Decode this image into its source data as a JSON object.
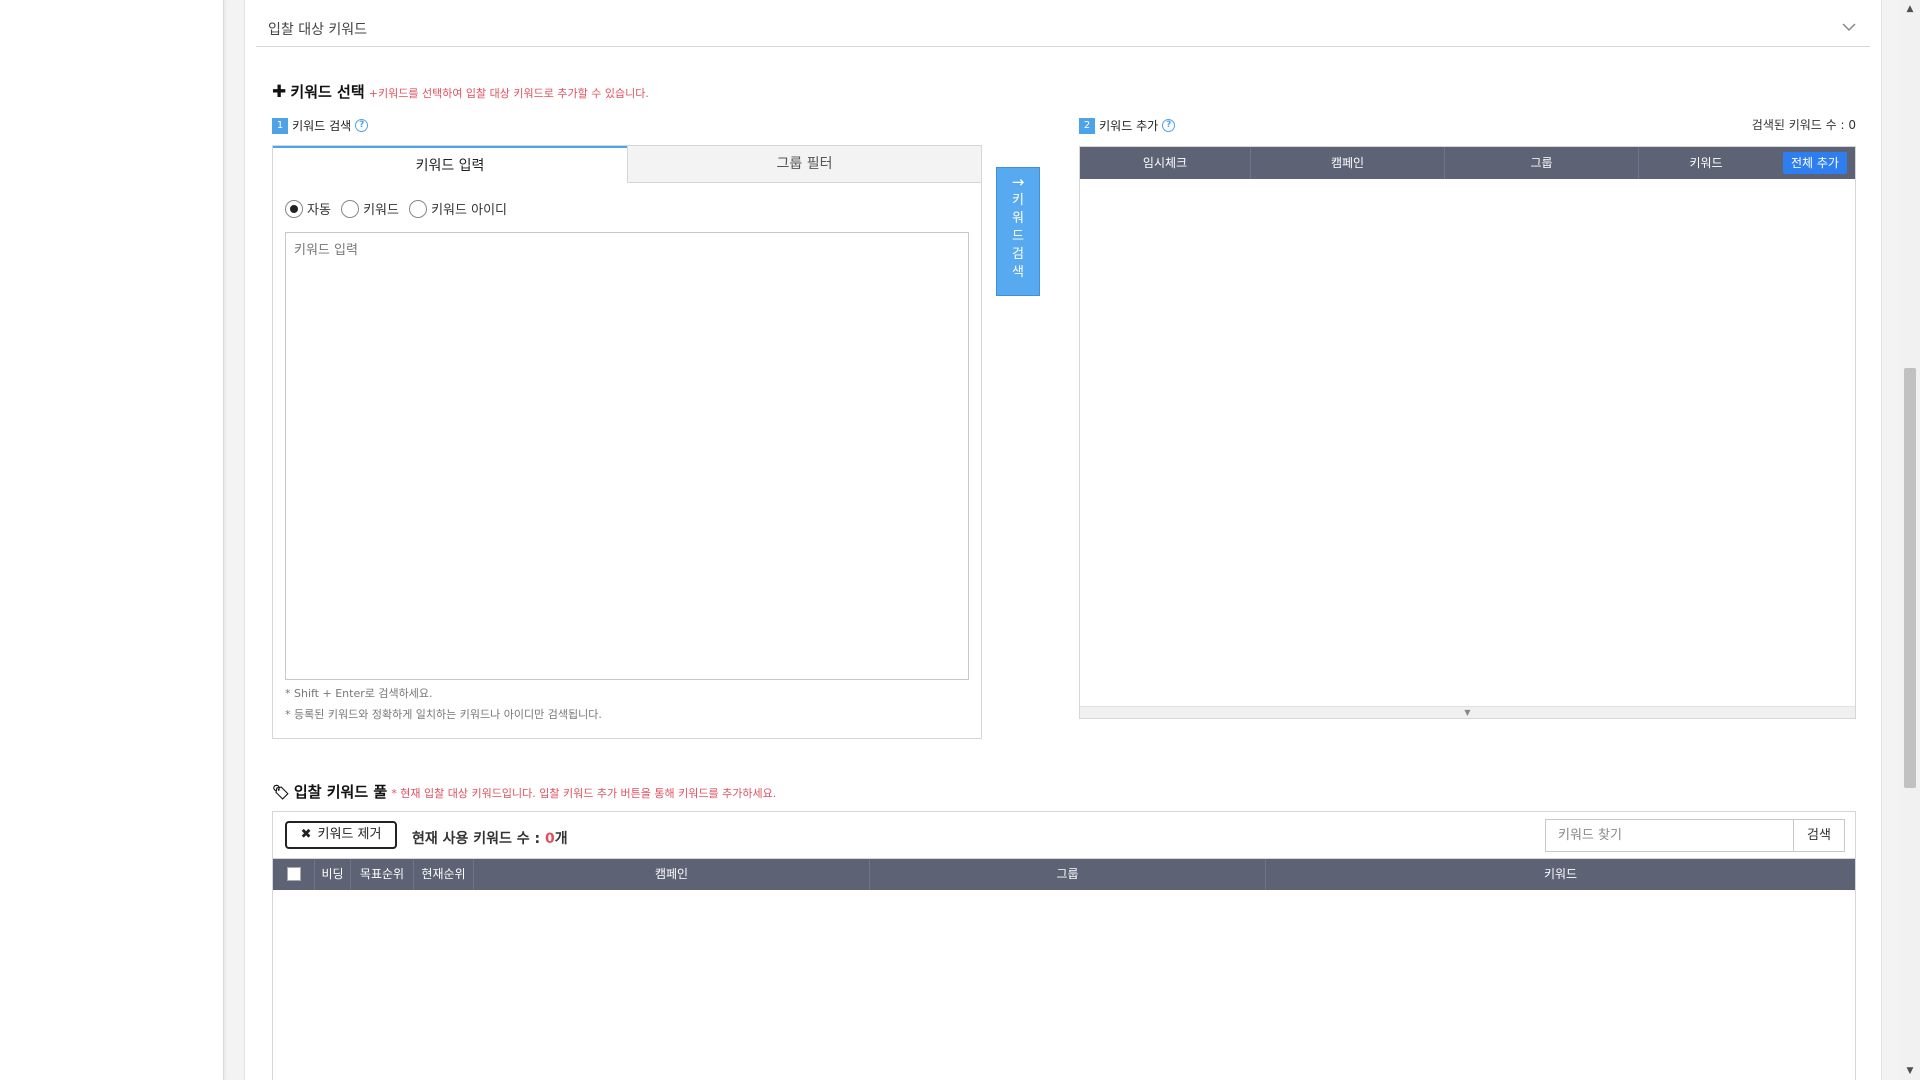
{
  "section": {
    "title": "입찰 대상 키워드"
  },
  "keyword_select": {
    "title": "키워드 선택",
    "description": "+키워드를 선택하여 입찰 대상 키워드로 추가할 수 있습니다.",
    "search": {
      "step": "1",
      "label": "키워드 검색",
      "tabs": [
        "키워드 입력",
        "그룹 필터"
      ],
      "radios": [
        {
          "label": "자동",
          "checked": true
        },
        {
          "label": "키워드",
          "checked": false
        },
        {
          "label": "키워드 아이디",
          "checked": false
        }
      ],
      "textarea_placeholder": "키워드 입력",
      "notes": [
        "* Shift + Enter로 검색하세요.",
        "* 등록된 키워드와 정확하게 일치하는 키워드나 아이디만 검색됩니다."
      ]
    },
    "search_button": {
      "arrow": "→",
      "chars": [
        "키",
        "워",
        "드",
        "검",
        "색"
      ]
    },
    "add": {
      "step": "2",
      "label": "키워드 추가",
      "count_text": "검색된 키워드 수 : 0",
      "columns": [
        "임시체크",
        "캠페인",
        "그룹",
        "키워드"
      ],
      "add_all_label": "전체 추가"
    }
  },
  "pool": {
    "title": "입찰 키워드 풀",
    "description": "* 현재 입찰 대상 키워드입니다. 입찰 키워드 추가 버튼을 통해 키워드를 추가하세요.",
    "remove_label": "키워드 제거",
    "count_prefix": "현재 사용 키워드 수 : ",
    "count_value": "0",
    "count_suffix": "개",
    "find_placeholder": "키워드 찾기",
    "find_button": "검색",
    "columns": [
      "비딩",
      "목표순위",
      "현재순위",
      "캠페인",
      "그룹",
      "키워드"
    ]
  },
  "colors": {
    "accent": "#4ea2e6",
    "table_header": "#5d6275",
    "add_all": "#2f7ef0",
    "description_red": "#e0515f"
  }
}
